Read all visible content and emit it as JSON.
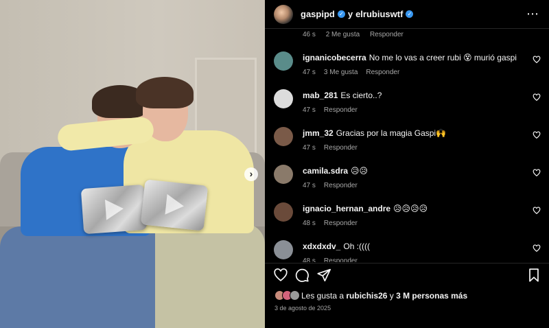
{
  "header": {
    "user1": "gaspipd",
    "connector": "y",
    "user2": "elrubiuswtf",
    "more_icon": "⋯"
  },
  "cut_comment": {
    "time": "46 s",
    "likes": "2 Me gusta",
    "reply": "Responder"
  },
  "comments": [
    {
      "user": "ignanicobecerra",
      "text": "No me lo vas a creer rubi 😵 murió gaspi",
      "time": "47 s",
      "likes": "3 Me gusta",
      "reply": "Responder",
      "avatar_color": "#5a8c8a"
    },
    {
      "user": "mab_281",
      "text": "Es cierto..?",
      "time": "47 s",
      "likes": "",
      "reply": "Responder",
      "avatar_color": "#dcdcdc"
    },
    {
      "user": "jmm_32",
      "text": "Gracias por la magia Gaspi🙌",
      "time": "47 s",
      "likes": "",
      "reply": "Responder",
      "avatar_color": "#7a5a48"
    },
    {
      "user": "camila.sdra",
      "text": "😥😥",
      "time": "47 s",
      "likes": "",
      "reply": "Responder",
      "avatar_color": "#8a7a6a"
    },
    {
      "user": "ignacio_hernan_andre",
      "text": "😥😥😥😥",
      "time": "48 s",
      "likes": "",
      "reply": "Responder",
      "avatar_color": "#6a4a3a"
    },
    {
      "user": "xdxdxdv_",
      "text": "Oh :((((",
      "time": "48 s",
      "likes": "",
      "reply": "Responder",
      "avatar_color": "#8a8f96"
    }
  ],
  "likes": {
    "prefix": "Les gusta a ",
    "user": "rubichis26",
    "suffix": " y ",
    "count": "3 M personas más"
  },
  "date": "3 de agosto de 2025",
  "carousel_next": "›",
  "colors": {
    "verified": "#3897f0",
    "background": "#000000",
    "secondary_text": "#a8a8a8"
  }
}
